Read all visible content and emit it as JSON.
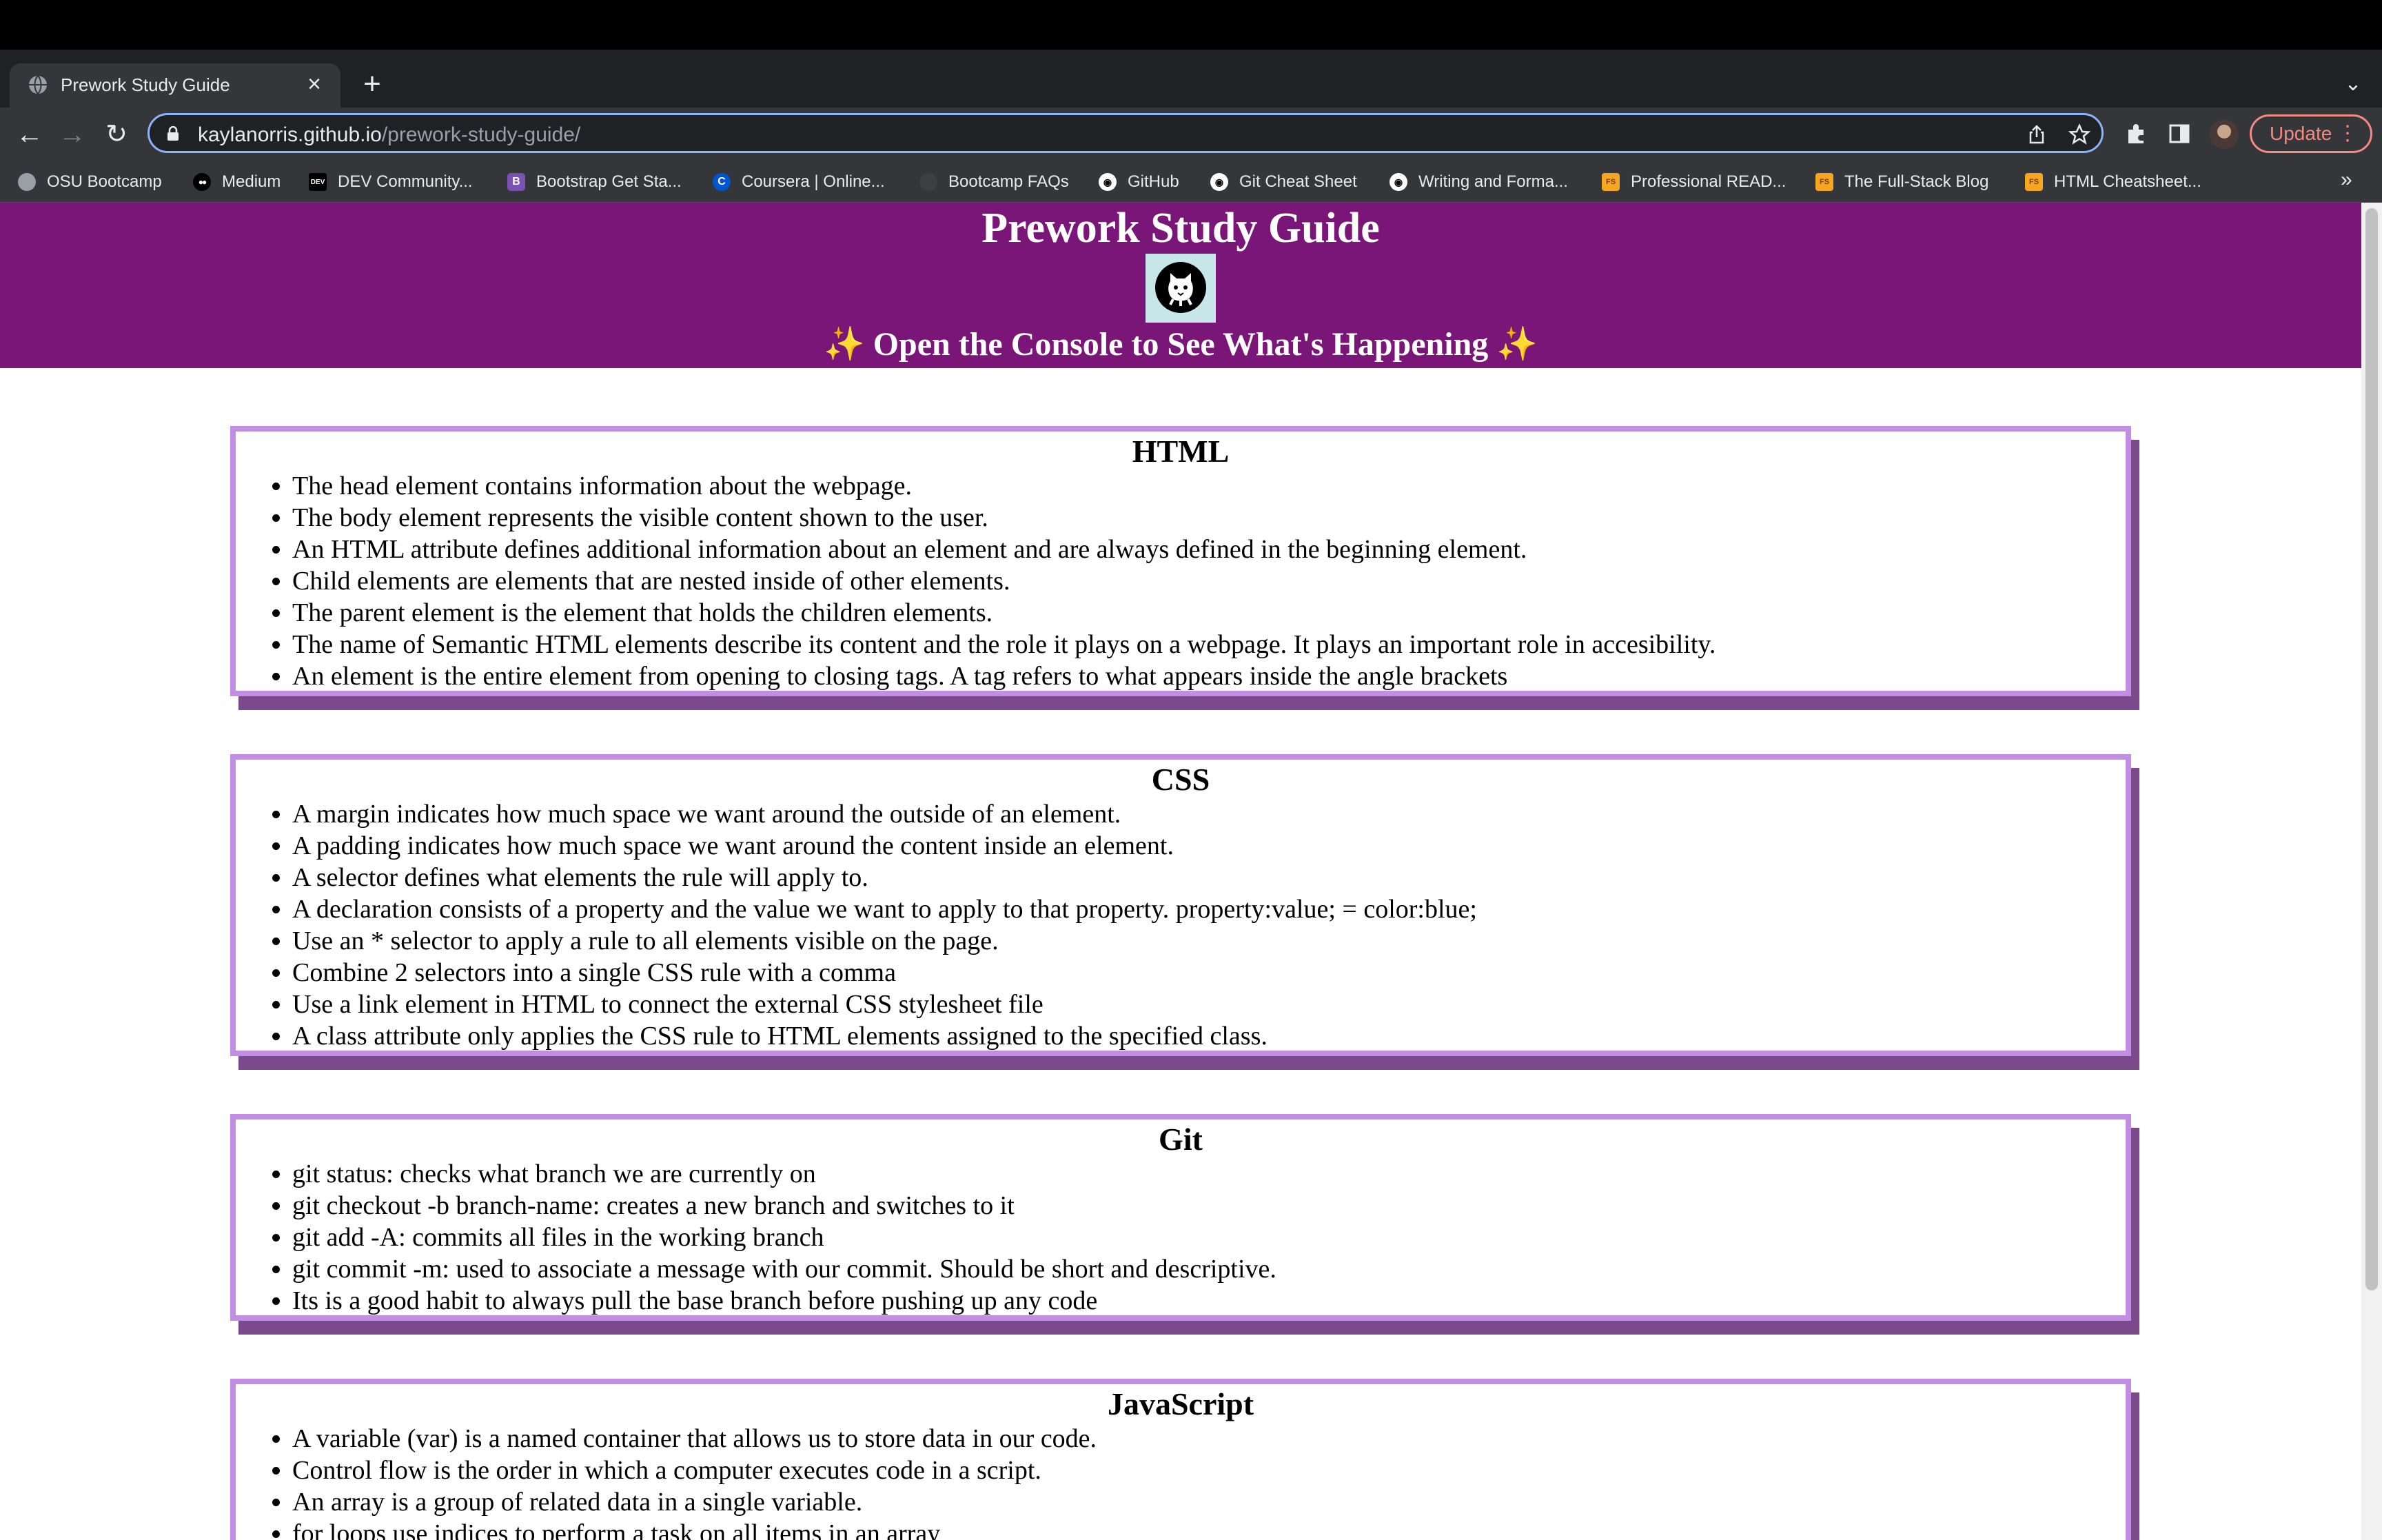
{
  "browser": {
    "tab": {
      "title": "Prework Study Guide"
    },
    "url": {
      "domain": "kaylanorris.github.io",
      "path": "/prework-study-guide/"
    },
    "update_label": "Update",
    "bookmarks": [
      {
        "label": "OSU Bootcamp",
        "icon": "globe-icon",
        "color": "#9aa0a6"
      },
      {
        "label": "Medium",
        "icon": "medium-icon",
        "color": "#000000"
      },
      {
        "label": "DEV Community...",
        "icon": "dev-icon",
        "color": "#000000"
      },
      {
        "label": "Bootstrap Get Sta...",
        "icon": "bootstrap-icon",
        "color": "#7952b3"
      },
      {
        "label": "Coursera | Online...",
        "icon": "coursera-icon",
        "color": "#0056d2"
      },
      {
        "label": "Bootcamp FAQs",
        "icon": "faq-icon",
        "color": "#3c4043"
      },
      {
        "label": "GitHub",
        "icon": "github-icon",
        "color": "#ffffff"
      },
      {
        "label": "Git Cheat Sheet",
        "icon": "github-icon",
        "color": "#ffffff"
      },
      {
        "label": "Writing and Forma...",
        "icon": "github-icon",
        "color": "#ffffff"
      },
      {
        "label": "Professional READ...",
        "icon": "fs-icon",
        "color": "#f5a623"
      },
      {
        "label": "The Full-Stack Blog",
        "icon": "fs-icon",
        "color": "#f5a623"
      },
      {
        "label": "HTML Cheatsheet...",
        "icon": "fs-icon",
        "color": "#f5a623"
      }
    ]
  },
  "page": {
    "title": "Prework Study Guide",
    "subtitle": "Open the Console to See What's Happening",
    "sparkle": "✨",
    "sections": [
      {
        "heading": "HTML",
        "items": [
          "The head element contains information about the webpage.",
          "The body element represents the visible content shown to the user.",
          "An HTML attribute defines additional information about an element and are always defined in the beginning element.",
          "Child elements are elements that are nested inside of other elements.",
          "The parent element is the element that holds the children elements.",
          "The name of Semantic HTML elements describe its content and the role it plays on a webpage. It plays an important role in accesibility.",
          "An element is the entire element from opening to closing tags. A tag refers to what appears inside the angle brackets"
        ]
      },
      {
        "heading": "CSS",
        "items": [
          "A margin indicates how much space we want around the outside of an element.",
          "A padding indicates how much space we want around the content inside an element.",
          "A selector defines what elements the rule will apply to.",
          "A declaration consists of a property and the value we want to apply to that property. property:value; = color:blue;",
          "Use an * selector to apply a rule to all elements visible on the page.",
          "Combine 2 selectors into a single CSS rule with a comma",
          "Use a link element in HTML to connect the external CSS stylesheet file",
          "A class attribute only applies the CSS rule to HTML elements assigned to the specified class."
        ]
      },
      {
        "heading": "Git",
        "items": [
          "git status: checks what branch we are currently on",
          "git checkout -b branch-name: creates a new branch and switches to it",
          "git add -A: commits all files in the working branch",
          "git commit -m: used to associate a message with our commit. Should be short and descriptive.",
          "Its is a good habit to always pull the base branch before pushing up any code"
        ]
      },
      {
        "heading": "JavaScript",
        "items": [
          "A variable (var) is a named container that allows us to store data in our code.",
          "Control flow is the order in which a computer executes code in a script.",
          "An array is a group of related data in a single variable.",
          "for loops use indices to perform a task on all items in an array"
        ]
      }
    ],
    "colors": {
      "header": "#7a1678",
      "card_border": "#c18ee4",
      "card_shadow": "#7a4a8c"
    }
  }
}
